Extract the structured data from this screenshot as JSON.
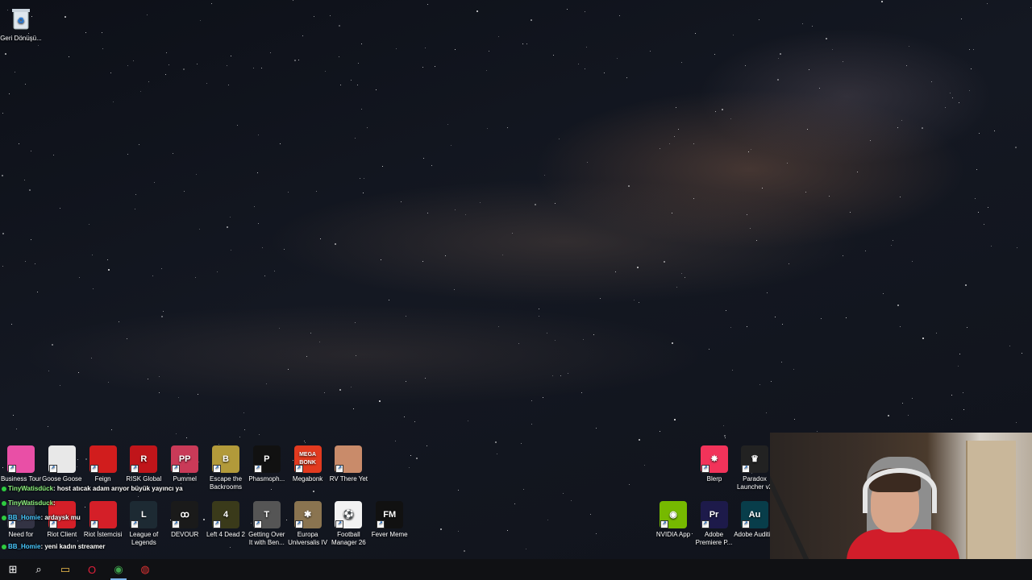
{
  "desktop": {
    "recycle_bin": {
      "label": "Geri Dönüşü...",
      "icon": "recycle-bin-icon"
    },
    "row1": [
      {
        "label": "Business Tour",
        "icon": "business-tour-icon",
        "color": "#e94fa6"
      },
      {
        "label": "Goose Goose",
        "icon": "goose-goose-icon",
        "color": "#e8e8e8"
      },
      {
        "label": "Feign",
        "icon": "feign-icon",
        "color": "#d11d1d"
      },
      {
        "label": "RISK Global",
        "icon": "risk-global-icon",
        "color": "#c0151a",
        "glyph": "R"
      },
      {
        "label": "Pummel",
        "icon": "pummel-party-icon",
        "color": "#c93a58",
        "glyph": "PP"
      },
      {
        "label": "Escape the Backrooms",
        "icon": "escape-backrooms-icon",
        "color": "#b29a3a",
        "glyph": "B"
      },
      {
        "label": "Phasmoph...",
        "icon": "phasmophobia-icon",
        "color": "#111111",
        "glyph": "P"
      },
      {
        "label": "Megabonk",
        "icon": "megabonk-icon",
        "color": "#e23a1f",
        "glyph": "MEGA BONK"
      },
      {
        "label": "RV There Yet",
        "icon": "rv-there-yet-icon",
        "color": "#c98b6a"
      }
    ],
    "row2": [
      {
        "label": "Need for",
        "icon": "need-for-speed-icon",
        "color": "#334"
      },
      {
        "label": "Riot Client",
        "icon": "riot-client-icon",
        "color": "#d41f28"
      },
      {
        "label": "Riot İstemcisi",
        "icon": "riot-istemcisi-icon",
        "color": "#d41f28"
      },
      {
        "label": "League of Legends",
        "icon": "league-of-legends-icon",
        "color": "#1d2a33",
        "glyph": "L"
      },
      {
        "label": "DEVOUR",
        "icon": "devour-icon",
        "color": "#1a1a1a",
        "glyph": "ꝏ"
      },
      {
        "label": "Left 4 Dead 2",
        "icon": "left4dead2-icon",
        "color": "#3a3a1a",
        "glyph": "4"
      },
      {
        "label": "Getting Over It with Ben...",
        "icon": "getting-over-it-icon",
        "color": "#555555",
        "glyph": "T"
      },
      {
        "label": "Europa Universalis IV",
        "icon": "europa-universalis-icon",
        "color": "#8a7450",
        "glyph": "✱"
      },
      {
        "label": "Football Manager 26",
        "icon": "football-manager-icon",
        "color": "#f2f2f2",
        "glyph": "⚽"
      },
      {
        "label": "Fever Meme",
        "icon": "fever-meme-icon",
        "color": "#111111",
        "glyph": "FM"
      }
    ],
    "right_row1": [
      {
        "label": "Blerp",
        "icon": "blerp-icon",
        "color": "#f2335a",
        "glyph": "✸"
      },
      {
        "label": "Paradox Launcher v2",
        "icon": "paradox-launcher-icon",
        "color": "#222222",
        "glyph": "♛"
      }
    ],
    "right_row2": [
      {
        "label": "NVIDIA App",
        "icon": "nvidia-app-icon",
        "color": "#76b900",
        "glyph": "◉"
      },
      {
        "label": "Adobe Premiere P...",
        "icon": "premiere-pro-icon",
        "color": "#1d1a4a",
        "glyph": "Pr"
      },
      {
        "label": "Adobe Auditi...",
        "icon": "audition-icon",
        "color": "#083d4a",
        "glyph": "Au"
      }
    ]
  },
  "chat": [
    {
      "user": "TinyWatisdück",
      "message": ": host atıcak adam arıyor büyük yayıncı ya"
    },
    {
      "user": "TinyWatisduck",
      "message": ":"
    },
    {
      "user": "BB_Homie",
      "message": ": ardaysk mu"
    },
    {
      "user": "BB_Homie",
      "message": ": yeni kadın streamer"
    }
  ],
  "taskbar": {
    "items": [
      {
        "name": "start-button",
        "glyph": "⊞",
        "icon": "windows-icon"
      },
      {
        "name": "search-button",
        "glyph": "⌕",
        "icon": "search-icon"
      },
      {
        "name": "file-explorer-button",
        "glyph": "▭",
        "icon": "folder-icon"
      },
      {
        "name": "opera-gx-button",
        "glyph": "O",
        "icon": "opera-gx-icon"
      },
      {
        "name": "chrome-button",
        "glyph": "◉",
        "icon": "chrome-icon"
      },
      {
        "name": "obs-button",
        "glyph": "◍",
        "icon": "obs-icon"
      }
    ]
  },
  "colors": {
    "taskbar": "#101114",
    "chat_user": "#8ef37e",
    "chat_user2": "#48c9ff"
  }
}
